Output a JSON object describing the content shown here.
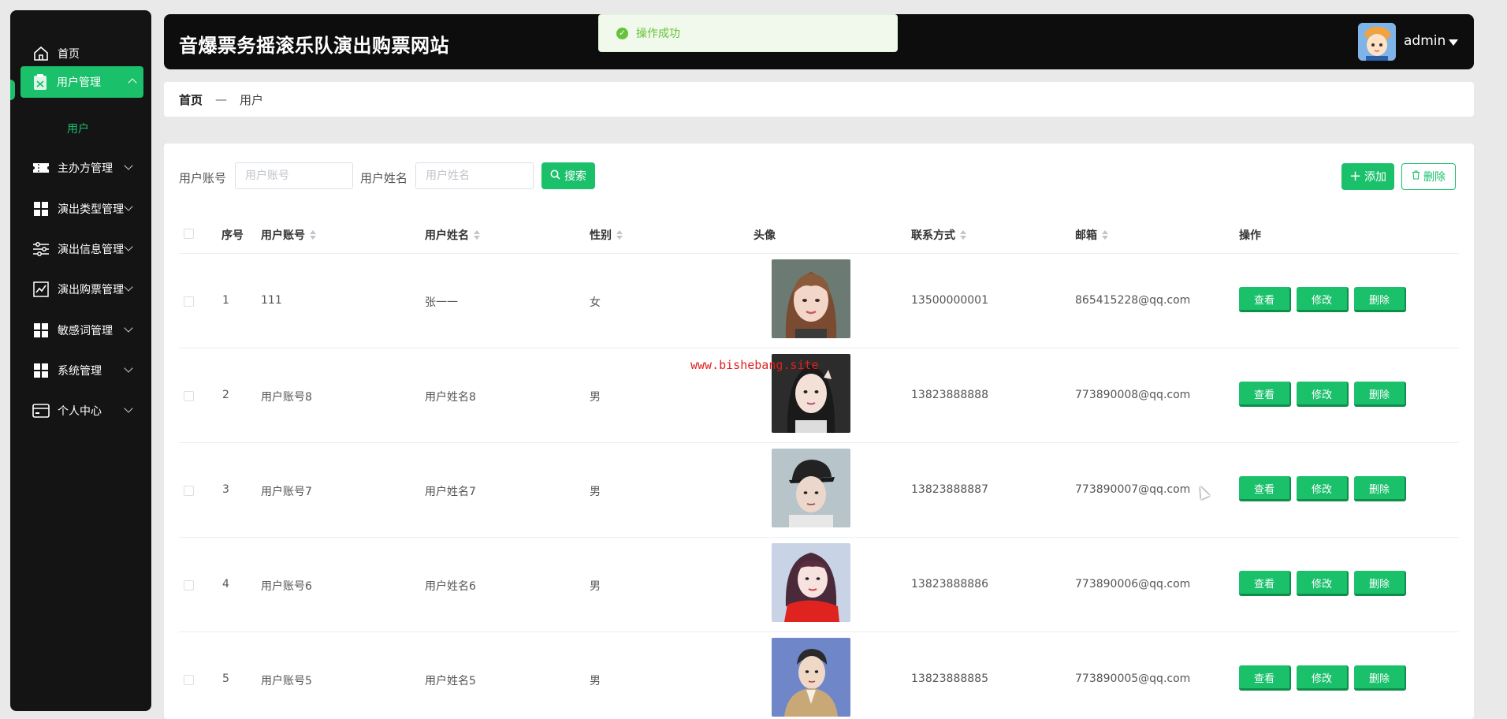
{
  "sidebar": {
    "items": [
      {
        "label": "首页",
        "icon": "home-icon"
      },
      {
        "label": "用户管理",
        "icon": "clipboard-icon"
      },
      {
        "label": "主办方管理",
        "icon": "ticket-icon"
      },
      {
        "label": "演出类型管理",
        "icon": "grid-icon"
      },
      {
        "label": "演出信息管理",
        "icon": "sliders-icon"
      },
      {
        "label": "演出购票管理",
        "icon": "chart-line-icon"
      },
      {
        "label": "敏感词管理",
        "icon": "grid-icon"
      },
      {
        "label": "系统管理",
        "icon": "grid-icon"
      },
      {
        "label": "个人中心",
        "icon": "wallet-icon"
      }
    ],
    "active_sub": "用户"
  },
  "header": {
    "title": "音爆票务摇滚乐队演出购票网站",
    "user": "admin"
  },
  "toast": {
    "text": "操作成功"
  },
  "breadcrumb": {
    "home": "首页",
    "sep": "—",
    "current": "用户"
  },
  "search": {
    "account_label": "用户账号",
    "account_placeholder": "用户账号",
    "name_label": "用户姓名",
    "name_placeholder": "用户姓名",
    "search_button": "搜索",
    "add_button": "添加",
    "delete_button": "删除"
  },
  "table": {
    "columns": [
      "序号",
      "用户账号",
      "用户姓名",
      "性别",
      "头像",
      "联系方式",
      "邮箱",
      "操作"
    ],
    "actions": {
      "view": "查看",
      "edit": "修改",
      "delete": "删除"
    },
    "rows": [
      {
        "index": "1",
        "account": "111",
        "name": "张一一",
        "gender": "女",
        "phone": "13500000001",
        "email": "865415228@qq.com"
      },
      {
        "index": "2",
        "account": "用户账号8",
        "name": "用户姓名8",
        "gender": "男",
        "phone": "13823888888",
        "email": "773890008@qq.com"
      },
      {
        "index": "3",
        "account": "用户账号7",
        "name": "用户姓名7",
        "gender": "男",
        "phone": "13823888887",
        "email": "773890007@qq.com"
      },
      {
        "index": "4",
        "account": "用户账号6",
        "name": "用户姓名6",
        "gender": "男",
        "phone": "13823888886",
        "email": "773890006@qq.com"
      },
      {
        "index": "5",
        "account": "用户账号5",
        "name": "用户姓名5",
        "gender": "男",
        "phone": "13823888885",
        "email": "773890005@qq.com"
      }
    ]
  },
  "watermark": "www.bishebang.site",
  "colors": {
    "accent": "#1bc06b",
    "sidebar_bg": "#141414",
    "header_bg": "#0d0d0d",
    "toast_green": "#67c23a"
  }
}
